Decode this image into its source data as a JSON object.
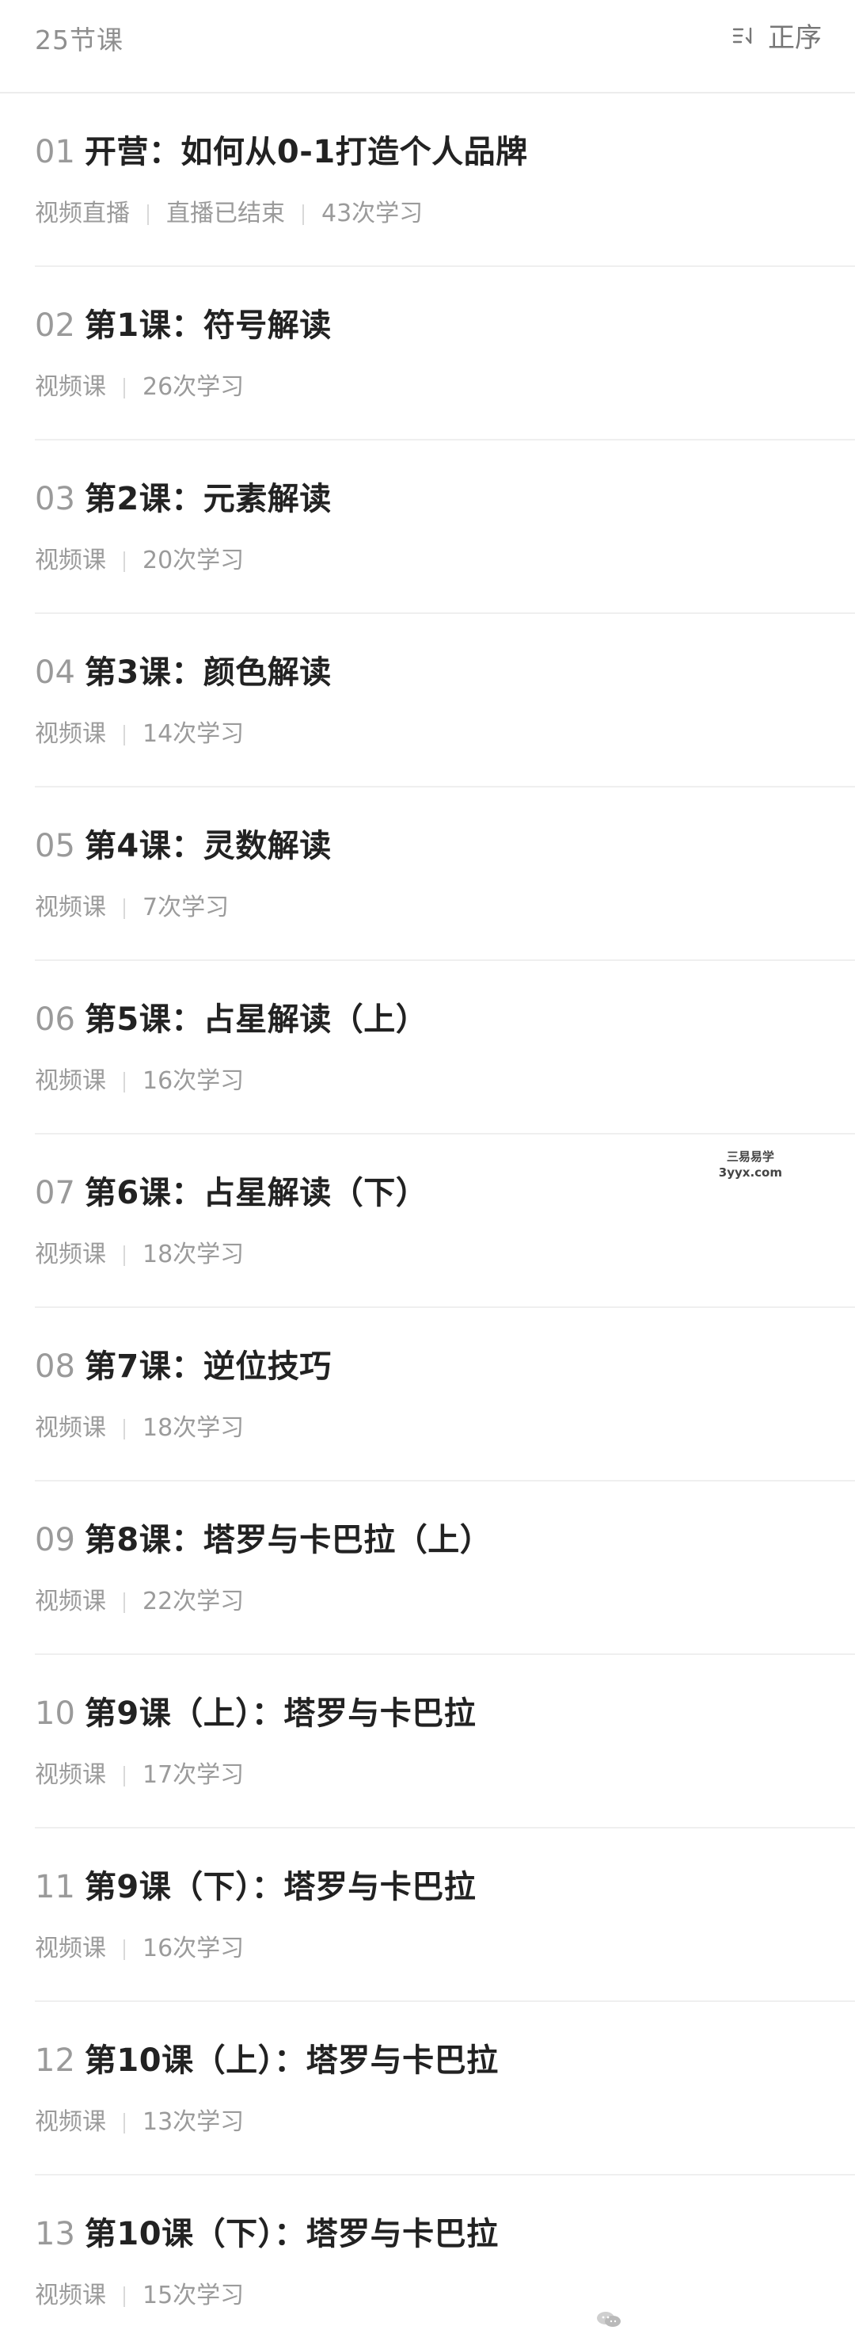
{
  "header": {
    "count": "25节课",
    "sort_label": "正序",
    "sort_icon": "sort-icon"
  },
  "lessons": [
    {
      "num": "01",
      "title": "开营：如何从0-1打造个人品牌",
      "meta": [
        "视频直播",
        "直播已结束",
        "43次学习"
      ]
    },
    {
      "num": "02",
      "title": "第1课：符号解读",
      "meta": [
        "视频课",
        "26次学习"
      ]
    },
    {
      "num": "03",
      "title": "第2课：元素解读",
      "meta": [
        "视频课",
        "20次学习"
      ]
    },
    {
      "num": "04",
      "title": "第3课：颜色解读",
      "meta": [
        "视频课",
        "14次学习"
      ]
    },
    {
      "num": "05",
      "title": "第4课：灵数解读",
      "meta": [
        "视频课",
        "7次学习"
      ]
    },
    {
      "num": "06",
      "title": "第5课：占星解读（上）",
      "meta": [
        "视频课",
        "16次学习"
      ]
    },
    {
      "num": "07",
      "title": "第6课：占星解读（下）",
      "meta": [
        "视频课",
        "18次学习"
      ]
    },
    {
      "num": "08",
      "title": "第7课：逆位技巧",
      "meta": [
        "视频课",
        "18次学习"
      ]
    },
    {
      "num": "09",
      "title": "第8课：塔罗与卡巴拉（上）",
      "meta": [
        "视频课",
        "22次学习"
      ]
    },
    {
      "num": "10",
      "title": "第9课（上）：塔罗与卡巴拉",
      "meta": [
        "视频课",
        "17次学习"
      ]
    },
    {
      "num": "11",
      "title": "第9课（下）：塔罗与卡巴拉",
      "meta": [
        "视频课",
        "16次学习"
      ]
    },
    {
      "num": "12",
      "title": "第10课（上）：塔罗与卡巴拉",
      "meta": [
        "视频课",
        "13次学习"
      ]
    },
    {
      "num": "13",
      "title": "第10课（下）：塔罗与卡巴拉",
      "meta": [
        "视频课",
        "15次学习"
      ]
    }
  ],
  "watermark": {
    "line1": "三易易学",
    "line2": "3yyx.com"
  },
  "colors": {
    "background": "#ffffff",
    "title": "#222222",
    "muted": "#9b9b9b",
    "divider": "#efefef"
  }
}
